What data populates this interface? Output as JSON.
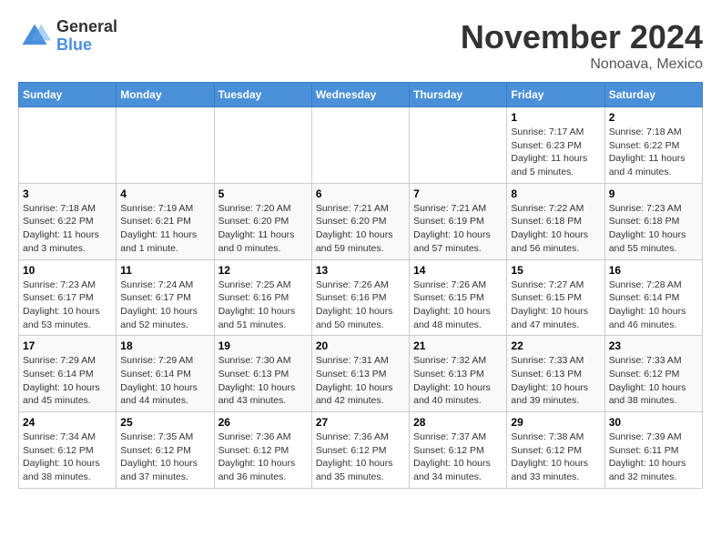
{
  "logo": {
    "general": "General",
    "blue": "Blue"
  },
  "title": "November 2024",
  "location": "Nonoava, Mexico",
  "days_of_week": [
    "Sunday",
    "Monday",
    "Tuesday",
    "Wednesday",
    "Thursday",
    "Friday",
    "Saturday"
  ],
  "weeks": [
    [
      {
        "day": "",
        "info": ""
      },
      {
        "day": "",
        "info": ""
      },
      {
        "day": "",
        "info": ""
      },
      {
        "day": "",
        "info": ""
      },
      {
        "day": "",
        "info": ""
      },
      {
        "day": "1",
        "info": "Sunrise: 7:17 AM\nSunset: 6:23 PM\nDaylight: 11 hours and 5 minutes."
      },
      {
        "day": "2",
        "info": "Sunrise: 7:18 AM\nSunset: 6:22 PM\nDaylight: 11 hours and 4 minutes."
      }
    ],
    [
      {
        "day": "3",
        "info": "Sunrise: 7:18 AM\nSunset: 6:22 PM\nDaylight: 11 hours and 3 minutes."
      },
      {
        "day": "4",
        "info": "Sunrise: 7:19 AM\nSunset: 6:21 PM\nDaylight: 11 hours and 1 minute."
      },
      {
        "day": "5",
        "info": "Sunrise: 7:20 AM\nSunset: 6:20 PM\nDaylight: 11 hours and 0 minutes."
      },
      {
        "day": "6",
        "info": "Sunrise: 7:21 AM\nSunset: 6:20 PM\nDaylight: 10 hours and 59 minutes."
      },
      {
        "day": "7",
        "info": "Sunrise: 7:21 AM\nSunset: 6:19 PM\nDaylight: 10 hours and 57 minutes."
      },
      {
        "day": "8",
        "info": "Sunrise: 7:22 AM\nSunset: 6:18 PM\nDaylight: 10 hours and 56 minutes."
      },
      {
        "day": "9",
        "info": "Sunrise: 7:23 AM\nSunset: 6:18 PM\nDaylight: 10 hours and 55 minutes."
      }
    ],
    [
      {
        "day": "10",
        "info": "Sunrise: 7:23 AM\nSunset: 6:17 PM\nDaylight: 10 hours and 53 minutes."
      },
      {
        "day": "11",
        "info": "Sunrise: 7:24 AM\nSunset: 6:17 PM\nDaylight: 10 hours and 52 minutes."
      },
      {
        "day": "12",
        "info": "Sunrise: 7:25 AM\nSunset: 6:16 PM\nDaylight: 10 hours and 51 minutes."
      },
      {
        "day": "13",
        "info": "Sunrise: 7:26 AM\nSunset: 6:16 PM\nDaylight: 10 hours and 50 minutes."
      },
      {
        "day": "14",
        "info": "Sunrise: 7:26 AM\nSunset: 6:15 PM\nDaylight: 10 hours and 48 minutes."
      },
      {
        "day": "15",
        "info": "Sunrise: 7:27 AM\nSunset: 6:15 PM\nDaylight: 10 hours and 47 minutes."
      },
      {
        "day": "16",
        "info": "Sunrise: 7:28 AM\nSunset: 6:14 PM\nDaylight: 10 hours and 46 minutes."
      }
    ],
    [
      {
        "day": "17",
        "info": "Sunrise: 7:29 AM\nSunset: 6:14 PM\nDaylight: 10 hours and 45 minutes."
      },
      {
        "day": "18",
        "info": "Sunrise: 7:29 AM\nSunset: 6:14 PM\nDaylight: 10 hours and 44 minutes."
      },
      {
        "day": "19",
        "info": "Sunrise: 7:30 AM\nSunset: 6:13 PM\nDaylight: 10 hours and 43 minutes."
      },
      {
        "day": "20",
        "info": "Sunrise: 7:31 AM\nSunset: 6:13 PM\nDaylight: 10 hours and 42 minutes."
      },
      {
        "day": "21",
        "info": "Sunrise: 7:32 AM\nSunset: 6:13 PM\nDaylight: 10 hours and 40 minutes."
      },
      {
        "day": "22",
        "info": "Sunrise: 7:33 AM\nSunset: 6:13 PM\nDaylight: 10 hours and 39 minutes."
      },
      {
        "day": "23",
        "info": "Sunrise: 7:33 AM\nSunset: 6:12 PM\nDaylight: 10 hours and 38 minutes."
      }
    ],
    [
      {
        "day": "24",
        "info": "Sunrise: 7:34 AM\nSunset: 6:12 PM\nDaylight: 10 hours and 38 minutes."
      },
      {
        "day": "25",
        "info": "Sunrise: 7:35 AM\nSunset: 6:12 PM\nDaylight: 10 hours and 37 minutes."
      },
      {
        "day": "26",
        "info": "Sunrise: 7:36 AM\nSunset: 6:12 PM\nDaylight: 10 hours and 36 minutes."
      },
      {
        "day": "27",
        "info": "Sunrise: 7:36 AM\nSunset: 6:12 PM\nDaylight: 10 hours and 35 minutes."
      },
      {
        "day": "28",
        "info": "Sunrise: 7:37 AM\nSunset: 6:12 PM\nDaylight: 10 hours and 34 minutes."
      },
      {
        "day": "29",
        "info": "Sunrise: 7:38 AM\nSunset: 6:12 PM\nDaylight: 10 hours and 33 minutes."
      },
      {
        "day": "30",
        "info": "Sunrise: 7:39 AM\nSunset: 6:11 PM\nDaylight: 10 hours and 32 minutes."
      }
    ]
  ]
}
